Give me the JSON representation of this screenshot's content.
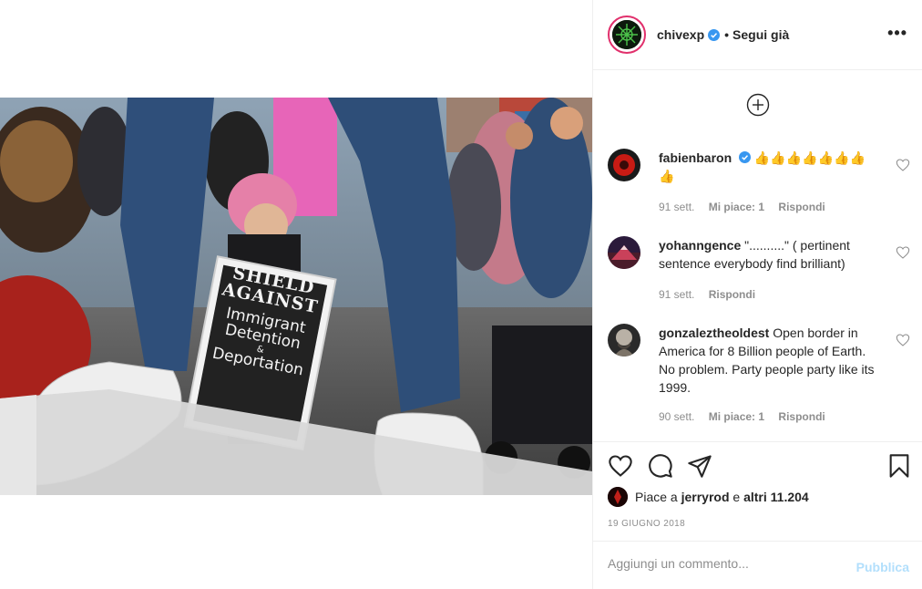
{
  "header": {
    "username": "chivexp",
    "separator": "•",
    "follow_label": "Segui già",
    "more_label": "•••"
  },
  "comments": [
    {
      "username": "fabienbaron",
      "verified": true,
      "text": "👍👍👍👍👍👍👍👍",
      "time": "91 sett.",
      "likes": "Mi piace: 1",
      "reply": "Rispondi"
    },
    {
      "username": "yohanngence",
      "verified": false,
      "text": "\"..........\" ( pertinent sentence everybody find brilliant)",
      "time": "91 sett.",
      "reply": "Rispondi"
    },
    {
      "username": "gonzaleztheoldest",
      "verified": false,
      "text": "Open border in America for 8 Billion people of Earth. No problem. Party people party like its 1999.",
      "time": "90 sett.",
      "likes": "Mi piace: 1",
      "reply": "Rispondi"
    }
  ],
  "likes": {
    "prefix": "Piace a",
    "user": "jerryrod",
    "conj": "e",
    "others": "altri 11.204"
  },
  "date": "19 GIUGNO 2018",
  "add_comment": {
    "placeholder": "Aggiungi un commento...",
    "publish_label": "Pubblica"
  },
  "photo": {
    "sign_lines": [
      "SHIELD",
      "AGAINST",
      "Immigrant",
      "Detention",
      "&",
      "Deportation"
    ]
  },
  "colors": {
    "verified_blue": "#3897f0",
    "publish_disabled": "#b2dffc",
    "secondary_text": "#8e8e8e",
    "divider": "#efefef"
  }
}
